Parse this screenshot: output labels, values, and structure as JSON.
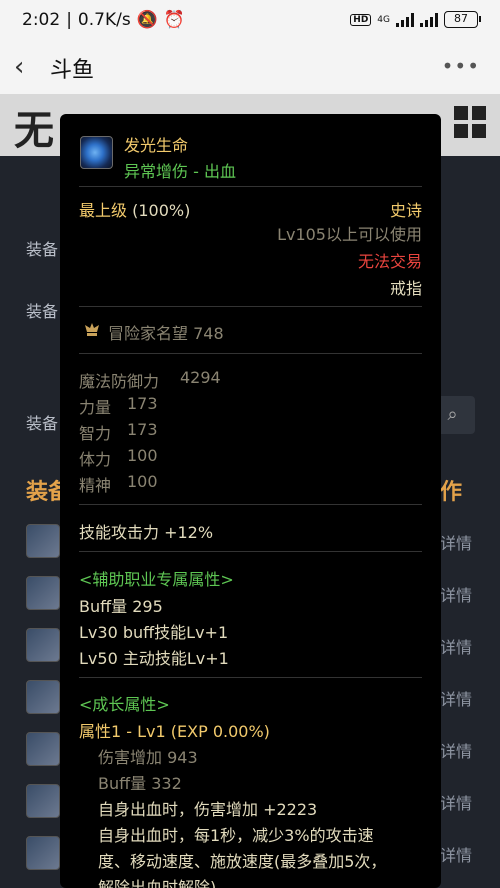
{
  "status_bar": {
    "time": "2:02",
    "speed": "0.7K/s",
    "hd": "HD",
    "net": "4G",
    "battery": "87"
  },
  "nav": {
    "title": "斗鱼"
  },
  "background": {
    "label_1": "装备",
    "label_2": "装备",
    "label_3": "装备",
    "head_left": "装备",
    "head_right": "作",
    "row_right": "详情"
  },
  "item": {
    "name": "发光生命",
    "subtitle": "异常增伤 - 出血",
    "grade": "最上级",
    "grade_pct": "(100%)",
    "rarity": "史诗",
    "level_req": "Lv105以上可以使用",
    "trade": "无法交易",
    "slot": "戒指",
    "fame": "冒险家名望 748",
    "stats": [
      {
        "label": "魔法防御力",
        "value": "4294"
      },
      {
        "label": "力量",
        "value": "173"
      },
      {
        "label": "智力",
        "value": "173"
      },
      {
        "label": "体力",
        "value": "100"
      },
      {
        "label": "精神",
        "value": "100"
      }
    ],
    "skill_attack": "技能攻击力  +12%",
    "support_header": "<辅助职业专属属性>",
    "support_lines": [
      "Buff量   295",
      "Lv30 buff技能Lv+1",
      "Lv50 主动技能Lv+1"
    ],
    "growth_header": "<成长属性>",
    "growth_attr": "属性1 - Lv1 (EXP 0.00%)",
    "growth_dmg": "伤害增加   943",
    "growth_buff": "Buff量   332",
    "growth_effect_1": "自身出血时，伤害增加 +2223",
    "growth_effect_2a": "自身出血时，每1秒，减少3%的攻击速",
    "growth_effect_2b": "度、移动速度、施放速度(最多叠加5次，",
    "growth_effect_2c": "解除出血时解除)"
  },
  "colors": {
    "gold": "#f2ca6c",
    "red": "#e9443e",
    "green": "#5ec653",
    "text": "#e2dbbd",
    "grey": "#8a8472"
  }
}
